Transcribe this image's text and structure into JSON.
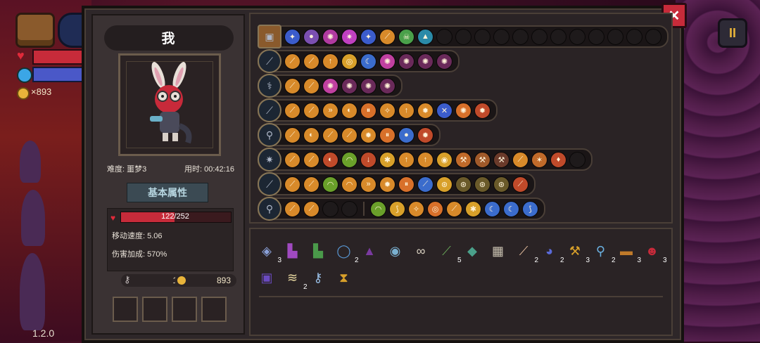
{
  "hud": {
    "gold": "×893",
    "version": "1.2.0",
    "pause_label": "II",
    "help_label": "?"
  },
  "close_label": "✕",
  "player": {
    "name": "我",
    "difficulty": "难度: 噩梦3",
    "time": "用时: 00:42:16",
    "section_title": "基本属性",
    "hp_text": "122/252",
    "hp_fraction": 0.484,
    "move_speed": "移动速度: 5.06",
    "damage_bonus": "伤害加成: 570%",
    "keys": "1",
    "coins": "893"
  },
  "colors": {
    "accent": "#e8b43a",
    "hp": "#c72b3a",
    "panel": "#2e2729",
    "border": "#4a3f37"
  },
  "rows": [
    {
      "weapon_icon": "treasure-chest-icon",
      "icons": [
        [
          "butterfly",
          "#3b5ccc",
          "✦"
        ],
        [
          "orb",
          "#7b4fb0",
          "●"
        ],
        [
          "vortex",
          "#b03aa0",
          "✺"
        ],
        [
          "star",
          "#c040c0",
          "✷"
        ],
        [
          "spirit",
          "#3b5ccc",
          "✦"
        ],
        [
          "claw",
          "#d88a2a",
          "⟋"
        ],
        [
          "skull",
          "#4aa04a",
          "☠"
        ],
        [
          "teal-wave",
          "#2a8aa8",
          "▲"
        ],
        [
          "empty",
          "#1e1a1b",
          ""
        ],
        [
          "empty",
          "#1e1a1b",
          ""
        ],
        [
          "empty",
          "#1e1a1b",
          ""
        ],
        [
          "empty",
          "#1e1a1b",
          ""
        ],
        [
          "empty",
          "#1e1a1b",
          ""
        ],
        [
          "empty",
          "#1e1a1b",
          ""
        ],
        [
          "empty",
          "#1e1a1b",
          ""
        ],
        [
          "empty",
          "#1e1a1b",
          ""
        ],
        [
          "empty",
          "#1e1a1b",
          ""
        ],
        [
          "empty",
          "#1e1a1b",
          ""
        ],
        [
          "empty",
          "#1e1a1b",
          ""
        ],
        [
          "empty",
          "#1e1a1b",
          ""
        ]
      ]
    },
    {
      "weapon_icon": "sword-icon",
      "icons": [
        [
          "claw-buff",
          "#d88a2a",
          "⟋"
        ],
        [
          "claw-up",
          "#d88a2a",
          "⟋"
        ],
        [
          "arrow-up",
          "#d88a2a",
          "↑"
        ],
        [
          "target",
          "#d8a02a",
          "◎"
        ],
        [
          "moon",
          "#3b6ccc",
          "☾"
        ],
        [
          "splash",
          "#c040a0",
          "✺"
        ],
        [
          "splash-dim",
          "#6a2a5a",
          "✺"
        ],
        [
          "splash-dim",
          "#6a2a5a",
          "✺"
        ],
        [
          "splash-dim",
          "#6a2a5a",
          "✺"
        ]
      ]
    },
    {
      "weapon_icon": "staff-icon",
      "icons": [
        [
          "claw-buff",
          "#d88a2a",
          "⟋"
        ],
        [
          "claw-up",
          "#d88a2a",
          "⟋"
        ],
        [
          "splash",
          "#c040a0",
          "✺"
        ],
        [
          "splash-dim",
          "#6a2a5a",
          "✺"
        ],
        [
          "splash-dim",
          "#6a2a5a",
          "✺"
        ],
        [
          "splash-dim",
          "#6a2a5a",
          "✺"
        ]
      ]
    },
    {
      "weapon_icon": "blade-icon",
      "icons": [
        [
          "claw-buff",
          "#d88a2a",
          "⟋"
        ],
        [
          "claw-up",
          "#d88a2a",
          "⟋"
        ],
        [
          "chevrons",
          "#d88a2a",
          "»"
        ],
        [
          "spin",
          "#d88a2a",
          "◐"
        ],
        [
          "pause",
          "#d8702a",
          "⏸"
        ],
        [
          "trident",
          "#d88a2a",
          "✧"
        ],
        [
          "arrow-up",
          "#d88a2a",
          "↑"
        ],
        [
          "sun",
          "#d88a2a",
          "✹"
        ],
        [
          "cross-blue",
          "#3b5ccc",
          "✕"
        ],
        [
          "burst",
          "#d8702a",
          "✺"
        ],
        [
          "fire",
          "#c04a2a",
          "✹"
        ]
      ]
    },
    {
      "weapon_icon": "wand-icon",
      "icons": [
        [
          "claw-buff",
          "#d88a2a",
          "⟋"
        ],
        [
          "swirl",
          "#d88a2a",
          "◐"
        ],
        [
          "claw-up",
          "#d88a2a",
          "⟋"
        ],
        [
          "claw",
          "#d88a2a",
          "⟋"
        ],
        [
          "sun",
          "#d88a2a",
          "✹"
        ],
        [
          "pause",
          "#d8702a",
          "⏸"
        ],
        [
          "orb-blue",
          "#3b6ccc",
          "●"
        ],
        [
          "fire",
          "#c04a2a",
          "✹"
        ]
      ]
    },
    {
      "weapon_icon": "scepter-icon",
      "icons": [
        [
          "claw-buff",
          "#d88a2a",
          "⟋"
        ],
        [
          "claw-up",
          "#d88a2a",
          "⟋"
        ],
        [
          "swirl-red",
          "#c04a2a",
          "◐"
        ],
        [
          "arc-green",
          "#6aa02a",
          "◠"
        ],
        [
          "drop",
          "#c04a2a",
          "↓"
        ],
        [
          "gear",
          "#d8a02a",
          "✱"
        ],
        [
          "arrow-up",
          "#d88a2a",
          "↑"
        ],
        [
          "arrow-up",
          "#d88a2a",
          "↑"
        ],
        [
          "eye",
          "#d8a02a",
          "◉"
        ],
        [
          "hammer",
          "#c06a2a",
          "⚒"
        ],
        [
          "hammer",
          "#a05a2a",
          "⚒"
        ],
        [
          "hammer-dim",
          "#6a3a2a",
          "⚒"
        ],
        [
          "claw",
          "#d88a2a",
          "⟋"
        ],
        [
          "star-claw",
          "#c06a2a",
          "✶"
        ],
        [
          "leaf",
          "#c04a2a",
          "♦"
        ],
        [
          "empty",
          "#1e1a1b",
          ""
        ]
      ]
    },
    {
      "weapon_icon": "spear-icon",
      "icons": [
        [
          "claw-buff",
          "#d88a2a",
          "⟋"
        ],
        [
          "claw-up",
          "#d88a2a",
          "⟋"
        ],
        [
          "arc",
          "#6aa02a",
          "◠"
        ],
        [
          "arc-orange",
          "#d88a2a",
          "◠"
        ],
        [
          "chevrons",
          "#d88a2a",
          "»"
        ],
        [
          "sun",
          "#d88a2a",
          "✹"
        ],
        [
          "pause",
          "#d8702a",
          "⏸"
        ],
        [
          "slash-blue",
          "#3b6ccc",
          "⟋"
        ],
        [
          "signal",
          "#d8a02a",
          "⊛"
        ],
        [
          "signal-dim",
          "#6a5a2a",
          "⊛"
        ],
        [
          "signal-dim",
          "#6a5a2a",
          "⊛"
        ],
        [
          "signal-dim",
          "#6a5a2a",
          "⊛"
        ],
        [
          "claw-red",
          "#c04a2a",
          "⟋"
        ]
      ]
    },
    {
      "weapon_icon": "rod-icon",
      "icons": [
        [
          "claw-buff",
          "#d88a2a",
          "⟋"
        ],
        [
          "claw-up",
          "#d88a2a",
          "⟋"
        ],
        [
          "empty",
          "#1e1a1b",
          ""
        ],
        [
          "empty",
          "#1e1a1b",
          ""
        ]
      ],
      "icons2": [
        [
          "arc-green",
          "#6aa02a",
          "◠"
        ],
        [
          "hook",
          "#d8a02a",
          "⟆"
        ],
        [
          "trident",
          "#d88a2a",
          "✧"
        ],
        [
          "target",
          "#d8702a",
          "◎"
        ],
        [
          "claw",
          "#d88a2a",
          "⟋"
        ],
        [
          "gear",
          "#d8a02a",
          "✱"
        ],
        [
          "moon-blue",
          "#3b6ccc",
          "☾"
        ],
        [
          "moon-blue",
          "#3b6ccc",
          "☾"
        ],
        [
          "wing-blue",
          "#3b6ccc",
          "⟆"
        ]
      ]
    }
  ],
  "items": [
    {
      "name": "crystal-icon",
      "glyph": "◈",
      "color": "#8aa0d8",
      "count": "3"
    },
    {
      "name": "boot-icon",
      "glyph": "▙",
      "color": "#a04ac0",
      "count": ""
    },
    {
      "name": "green-boot-icon",
      "glyph": "▙",
      "color": "#4a9a4a",
      "count": ""
    },
    {
      "name": "ring-icon",
      "glyph": "◯",
      "color": "#5a9ad8",
      "count": "2"
    },
    {
      "name": "cloak-icon",
      "glyph": "▲",
      "color": "#7a3aa0",
      "count": ""
    },
    {
      "name": "compass-icon",
      "glyph": "◉",
      "color": "#7ab0d0",
      "count": ""
    },
    {
      "name": "glasses-icon",
      "glyph": "∞",
      "color": "#d8d0c0",
      "count": ""
    },
    {
      "name": "pickaxe-icon",
      "glyph": "⟋",
      "color": "#6aaa5a",
      "count": "5"
    },
    {
      "name": "gem-icon",
      "glyph": "◆",
      "color": "#4aa08a",
      "count": ""
    },
    {
      "name": "armor-icon",
      "glyph": "▦",
      "color": "#c8c0b0",
      "count": ""
    },
    {
      "name": "feather-icon",
      "glyph": "⟋",
      "color": "#e8c0a0",
      "count": "2"
    },
    {
      "name": "dice-icon",
      "glyph": "◕",
      "color": "#5a6ad8",
      "count": "2"
    },
    {
      "name": "hammer-icon",
      "glyph": "⚒",
      "color": "#d8a02a",
      "count": "3"
    },
    {
      "name": "magnifier-icon",
      "glyph": "⚲",
      "color": "#6ab0e0",
      "count": "2"
    },
    {
      "name": "barrel-icon",
      "glyph": "▬",
      "color": "#c07a2a",
      "count": "3"
    },
    {
      "name": "demon-mask-icon",
      "glyph": "☻",
      "color": "#c82a3a",
      "count": "3"
    },
    {
      "name": "book-icon",
      "glyph": "▣",
      "color": "#6a4ac0",
      "count": ""
    },
    {
      "name": "teeth-icon",
      "glyph": "≋",
      "color": "#e8d8a0",
      "count": "2"
    },
    {
      "name": "key-icon",
      "glyph": "⚷",
      "color": "#9ac0e8",
      "count": ""
    },
    {
      "name": "hourglass-icon",
      "glyph": "⧗",
      "color": "#d8a02a",
      "count": ""
    }
  ]
}
